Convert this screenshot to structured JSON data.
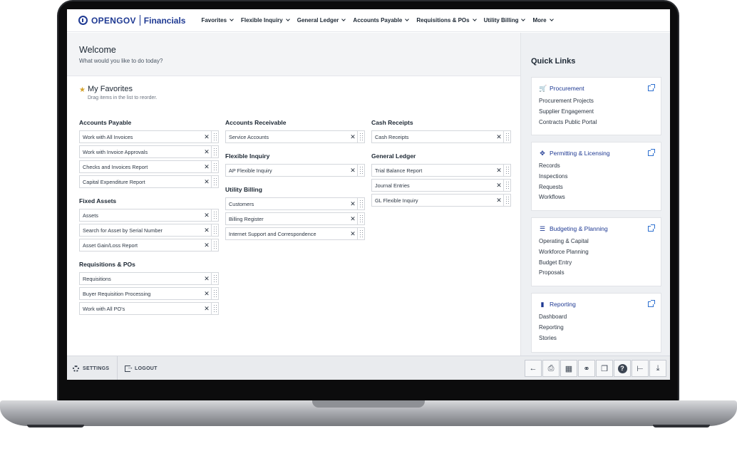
{
  "brand": {
    "name": "OPENGOV",
    "product": "Financials"
  },
  "nav": [
    "Favorites",
    "Flexible Inquiry",
    "General Ledger",
    "Accounts Payable",
    "Requisitions & POs",
    "Utility Billing",
    "More"
  ],
  "welcome": {
    "title": "Welcome",
    "subtitle": "What would you like to do today?"
  },
  "favorites": {
    "title": "My Favorites",
    "hint": "Drag items in the list to reorder.",
    "columns": [
      [
        {
          "title": "Accounts Payable",
          "items": [
            "Work with All Invoices",
            "Work with Invoice Approvals",
            "Checks and Invoices Report",
            "Capital Expenditure Report"
          ]
        },
        {
          "title": "Fixed Assets",
          "items": [
            "Assets",
            "Search for Asset by Serial Number",
            "Asset Gain/Loss Report"
          ]
        },
        {
          "title": "Requisitions & POs",
          "items": [
            "Requisitions",
            "Buyer Requisition Processing",
            "Work with All PO's"
          ]
        }
      ],
      [
        {
          "title": "Accounts Receivable",
          "items": [
            "Service Accounts"
          ]
        },
        {
          "title": "Flexible Inquiry",
          "items": [
            "AP Flexible Inquiry"
          ]
        },
        {
          "title": "Utility Billing",
          "items": [
            "Customers",
            "Billing Register",
            "Internet Support and Correspondence"
          ]
        }
      ],
      [
        {
          "title": "Cash Receipts",
          "items": [
            "Cash Receipts"
          ]
        },
        {
          "title": "General Ledger",
          "items": [
            "Trial Balance Report",
            "Journal Entries",
            "GL Flexible Inquiry"
          ]
        }
      ]
    ]
  },
  "quick_links": {
    "title": "Quick Links",
    "cards": [
      {
        "name": "Procurement",
        "icon": "cart-icon",
        "links": [
          "Procurement Projects",
          "Supplier Engagement",
          "Contracts Public Portal"
        ]
      },
      {
        "name": "Permitting & Licensing",
        "icon": "permit-icon",
        "links": [
          "Records",
          "Inspections",
          "Requests",
          "Workflows"
        ]
      },
      {
        "name": "Budgeting & Planning",
        "icon": "budget-icon",
        "links": [
          "Operating & Capital",
          "Workforce Planning",
          "Budget Entry",
          "Proposals"
        ]
      },
      {
        "name": "Reporting",
        "icon": "reporting-icon",
        "links": [
          "Dashboard",
          "Reporting",
          "Stories"
        ]
      }
    ]
  },
  "bottom": {
    "settings": "SETTINGS",
    "logout": "LOGOUT"
  },
  "tools": [
    "back-icon",
    "print-icon",
    "grid-icon",
    "binoculars-icon",
    "copy-icon",
    "help-icon",
    "tree-icon",
    "download-icon"
  ],
  "colors": {
    "brand": "#1f3a93",
    "link": "#2d6fcf",
    "star": "#d4a22a",
    "panel": "#eef0f3"
  }
}
